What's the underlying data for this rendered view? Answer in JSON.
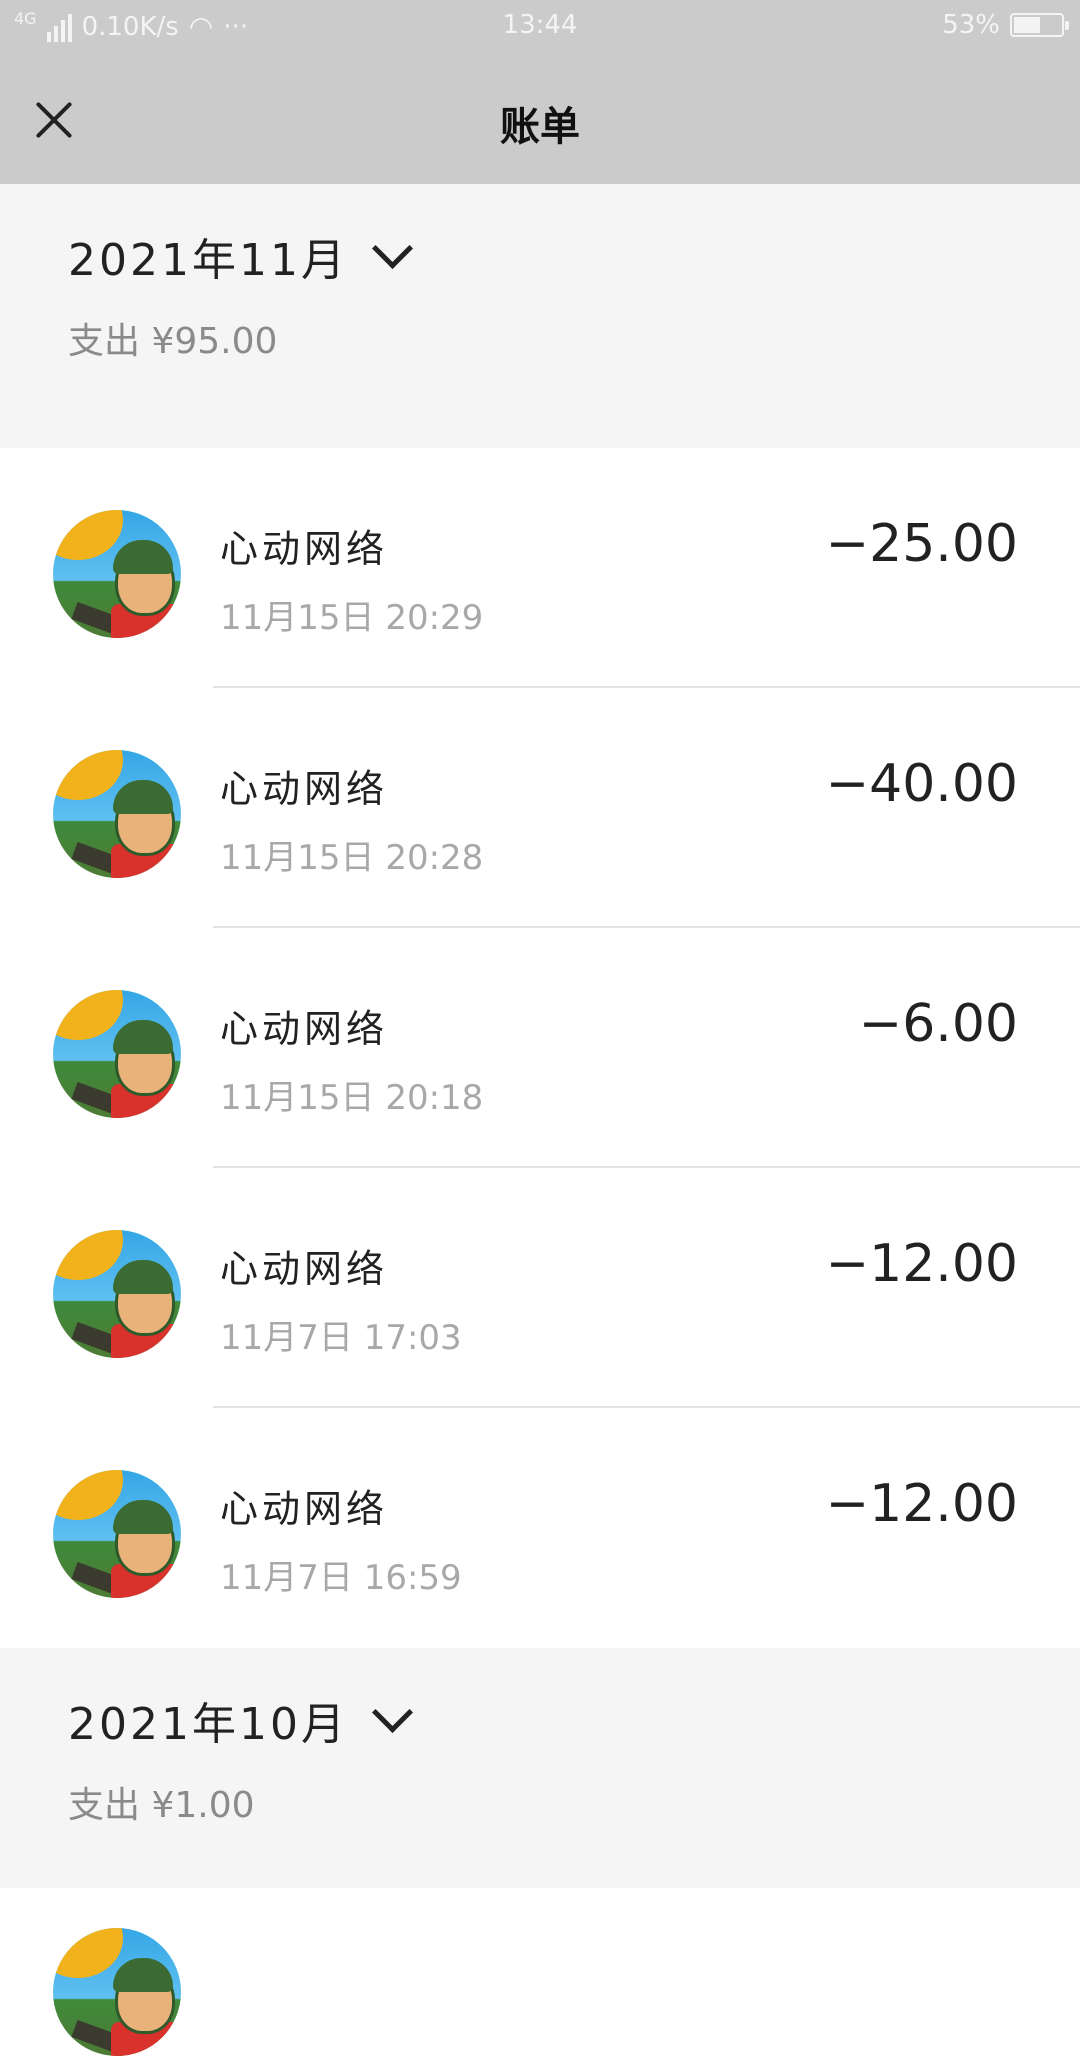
{
  "status_bar": {
    "network": "4G",
    "speed": "0.10K/s",
    "more": "···",
    "time": "13:44",
    "battery": "53%",
    "battery_level": 0.53
  },
  "nav": {
    "title": "账单"
  },
  "months": [
    {
      "title": "2021年11月",
      "spend": "支出 ¥95.00",
      "transactions": [
        {
          "name": "心动网络",
          "time": "11月15日 20:29",
          "amount": "−25.00"
        },
        {
          "name": "心动网络",
          "time": "11月15日 20:28",
          "amount": "−40.00"
        },
        {
          "name": "心动网络",
          "time": "11月15日 20:18",
          "amount": "−6.00"
        },
        {
          "name": "心动网络",
          "time": "11月7日 17:03",
          "amount": "−12.00"
        },
        {
          "name": "心动网络",
          "time": "11月7日 16:59",
          "amount": "−12.00"
        }
      ]
    },
    {
      "title": "2021年10月",
      "spend": "支出 ¥1.00"
    }
  ],
  "icons": {
    "close": "close-icon",
    "chevron": "chevron-down-icon",
    "avatar": "merchant-avatar-icon"
  },
  "colors": {
    "nav_bg": "#cbcbcb",
    "section_bg": "#f5f5f5",
    "secondary_text": "#a8a8a8"
  }
}
